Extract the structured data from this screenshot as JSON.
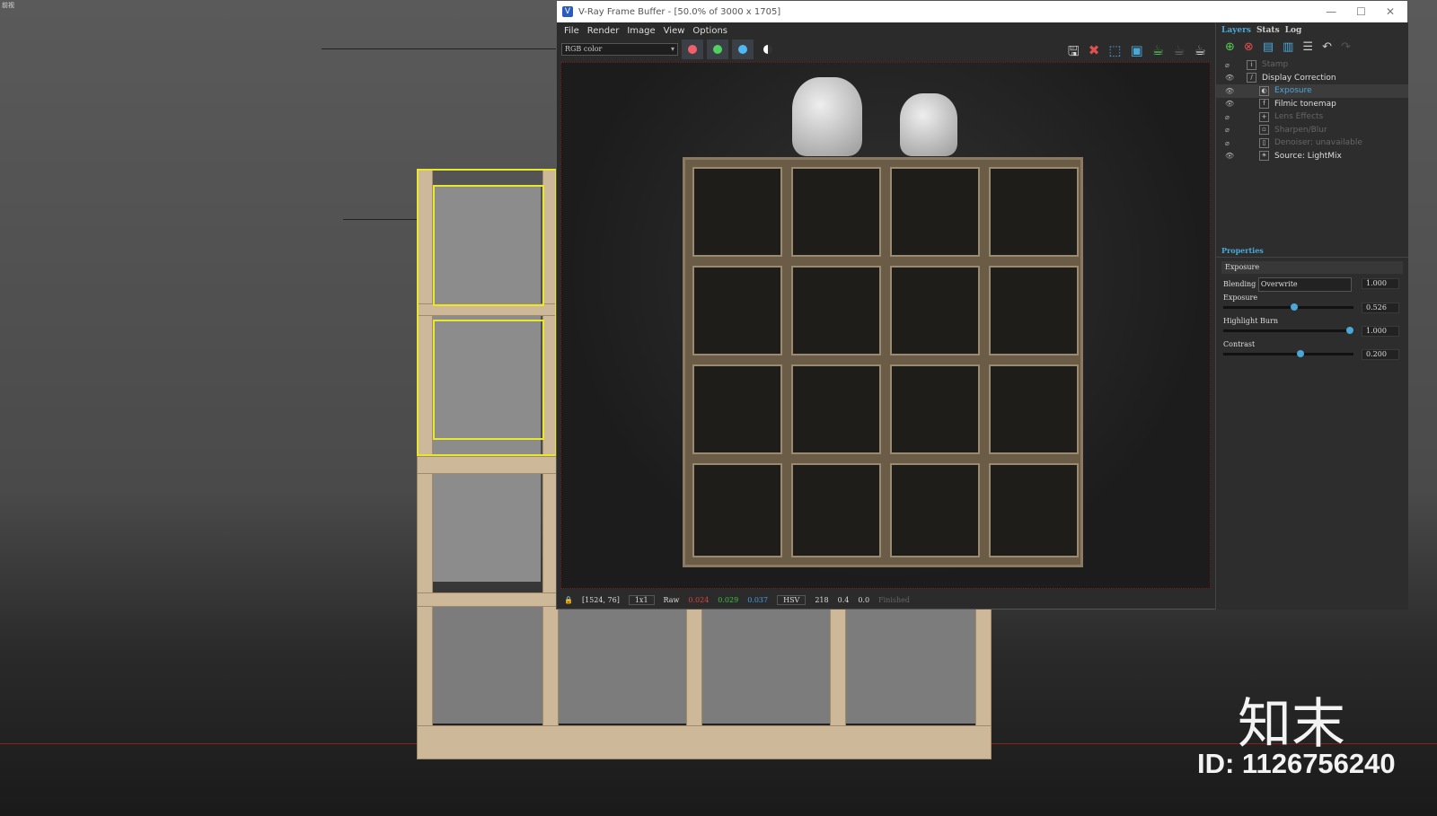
{
  "corner_label": "前视",
  "vfb": {
    "title": "V-Ray Frame Buffer - [50.0% of 3000 x 1705]",
    "window_buttons": [
      "—",
      "☐",
      "✕"
    ],
    "menu": [
      "File",
      "Render",
      "Image",
      "View",
      "Options"
    ],
    "channel": "RGB color",
    "channel_colors": {
      "red": "#f0606a",
      "green": "#50d060",
      "blue": "#50b8f0"
    },
    "toolbar_icons": [
      "save-icon",
      "clear-icon",
      "region-select-icon",
      "render-region-icon",
      "teapot-render-icon",
      "teapot-disabled-icon",
      "teapot-icon"
    ],
    "status": {
      "coords": "[1524, 76]",
      "ratio": "1x1",
      "mode": "Raw",
      "r": "0.024",
      "g": "0.029",
      "b": "0.037",
      "colorspace": "HSV",
      "h": "218",
      "s": "0.4",
      "v": "0.0",
      "state": "Finished"
    }
  },
  "panel": {
    "tabs": [
      "Layers",
      "Stats",
      "Log"
    ],
    "layers": [
      {
        "name": "Stamp",
        "enabled": false,
        "indent": 0,
        "icon": "i"
      },
      {
        "name": "Display Correction",
        "enabled": true,
        "indent": 0,
        "icon": "/"
      },
      {
        "name": "Exposure",
        "enabled": true,
        "indent": 1,
        "icon": "◐",
        "selected": true
      },
      {
        "name": "Filmic tonemap",
        "enabled": true,
        "indent": 1,
        "icon": "f"
      },
      {
        "name": "Lens Effects",
        "enabled": false,
        "indent": 1,
        "icon": "+"
      },
      {
        "name": "Sharpen/Blur",
        "enabled": false,
        "indent": 1,
        "icon": "▫"
      },
      {
        "name": "Denoiser: unavailable",
        "enabled": false,
        "indent": 1,
        "icon": "▯"
      },
      {
        "name": "Source: LightMix",
        "enabled": true,
        "indent": 1,
        "icon": "☀"
      }
    ],
    "properties_title": "Properties",
    "layer_name": "Exposure",
    "blending_label": "Blending",
    "blending_value": "Overwrite",
    "blending_amount": "1.000",
    "sliders": [
      {
        "label": "Exposure",
        "value": "0.526",
        "fraction": 0.55
      },
      {
        "label": "Highlight Burn",
        "value": "1.000",
        "fraction": 1.0
      },
      {
        "label": "Contrast",
        "value": "0.200",
        "fraction": 0.6
      }
    ]
  },
  "watermark": {
    "logo": "知末",
    "id": "ID: 1126756240"
  }
}
